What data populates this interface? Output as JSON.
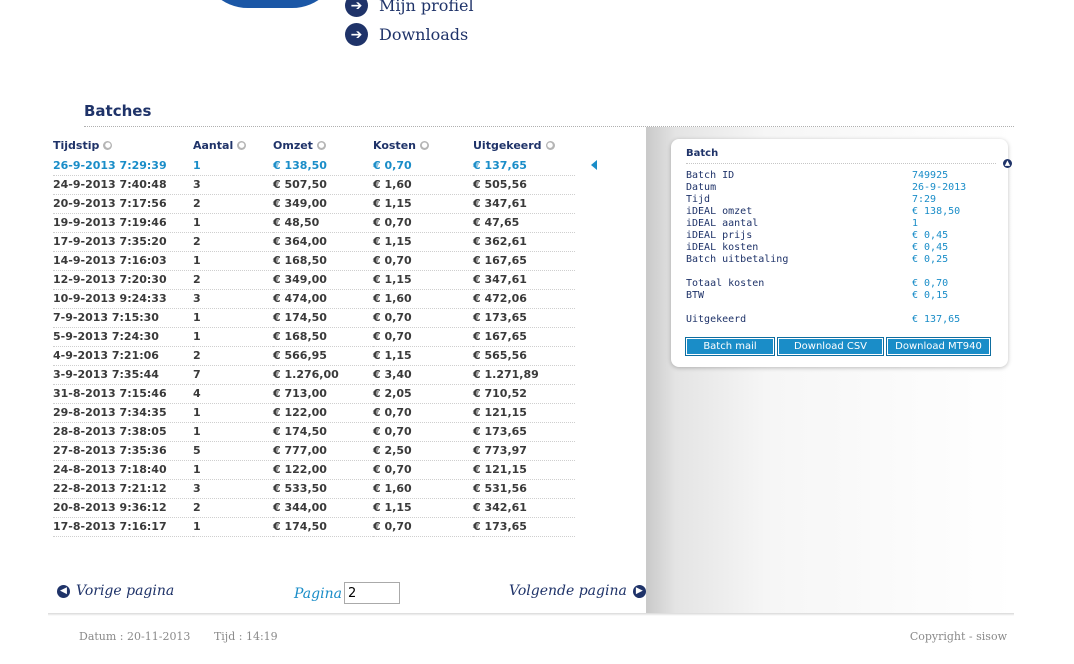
{
  "topnav": {
    "items": [
      {
        "label": "Mijn profiel",
        "icon": "arrow-right-icon"
      },
      {
        "label": "Downloads",
        "icon": "arrow-right-icon"
      }
    ]
  },
  "batches": {
    "title": "Batches",
    "columns": [
      "Tijdstip",
      "Aantal",
      "Omzet",
      "Kosten",
      "Uitgekeerd"
    ],
    "rows": [
      [
        "26-9-2013 7:29:39",
        "1",
        "€ 138,50",
        "€ 0,70",
        "€ 137,65"
      ],
      [
        "24-9-2013 7:40:48",
        "3",
        "€ 507,50",
        "€ 1,60",
        "€ 505,56"
      ],
      [
        "20-9-2013 7:17:56",
        "2",
        "€ 349,00",
        "€ 1,15",
        "€ 347,61"
      ],
      [
        "19-9-2013 7:19:46",
        "1",
        "€ 48,50",
        "€ 0,70",
        "€ 47,65"
      ],
      [
        "17-9-2013 7:35:20",
        "2",
        "€ 364,00",
        "€ 1,15",
        "€ 362,61"
      ],
      [
        "14-9-2013 7:16:03",
        "1",
        "€ 168,50",
        "€ 0,70",
        "€ 167,65"
      ],
      [
        "12-9-2013 7:20:30",
        "2",
        "€ 349,00",
        "€ 1,15",
        "€ 347,61"
      ],
      [
        "10-9-2013 9:24:33",
        "3",
        "€ 474,00",
        "€ 1,60",
        "€ 472,06"
      ],
      [
        "7-9-2013 7:15:30",
        "1",
        "€ 174,50",
        "€ 0,70",
        "€ 173,65"
      ],
      [
        "5-9-2013 7:24:30",
        "1",
        "€ 168,50",
        "€ 0,70",
        "€ 167,65"
      ],
      [
        "4-9-2013 7:21:06",
        "2",
        "€ 566,95",
        "€ 1,15",
        "€ 565,56"
      ],
      [
        "3-9-2013 7:35:44",
        "7",
        "€ 1.276,00",
        "€ 3,40",
        "€ 1.271,89"
      ],
      [
        "31-8-2013 7:15:46",
        "4",
        "€ 713,00",
        "€ 2,05",
        "€ 710,52"
      ],
      [
        "29-8-2013 7:34:35",
        "1",
        "€ 122,00",
        "€ 0,70",
        "€ 121,15"
      ],
      [
        "28-8-2013 7:38:05",
        "1",
        "€ 174,50",
        "€ 0,70",
        "€ 173,65"
      ],
      [
        "27-8-2013 7:35:36",
        "5",
        "€ 777,00",
        "€ 2,50",
        "€ 773,97"
      ],
      [
        "24-8-2013 7:18:40",
        "1",
        "€ 122,00",
        "€ 0,70",
        "€ 121,15"
      ],
      [
        "22-8-2013 7:21:12",
        "3",
        "€ 533,50",
        "€ 1,60",
        "€ 531,56"
      ],
      [
        "20-8-2013 9:36:12",
        "2",
        "€ 344,00",
        "€ 1,15",
        "€ 342,61"
      ],
      [
        "17-8-2013 7:16:17",
        "1",
        "€ 174,50",
        "€ 0,70",
        "€ 173,65"
      ]
    ],
    "selected_index": 0
  },
  "pagination": {
    "prev_label": "Vorige pagina",
    "next_label": "Volgende pagina",
    "page_label": "Pagina",
    "page_value": "2"
  },
  "detail": {
    "title": "Batch",
    "rows": [
      {
        "key": "Batch ID",
        "value": "749925"
      },
      {
        "key": "Datum",
        "value": "26-9-2013"
      },
      {
        "key": "Tijd",
        "value": "7:29"
      },
      {
        "key": "iDEAL omzet",
        "value": "€ 138,50"
      },
      {
        "key": "iDEAL aantal",
        "value": "1"
      },
      {
        "key": "iDEAL prijs",
        "value": "€ 0,45"
      },
      {
        "key": "iDEAL kosten",
        "value": "€ 0,45"
      },
      {
        "key": "Batch uitbetaling",
        "value": "€ 0,25"
      },
      null,
      {
        "key": "Totaal kosten",
        "value": "€ 0,70"
      },
      {
        "key": "BTW",
        "value": "€ 0,15"
      },
      null,
      {
        "key": "Uitgekeerd",
        "value": "€ 137,65"
      }
    ],
    "buttons": [
      "Batch mail",
      "Download CSV",
      "Download MT940"
    ]
  },
  "footer": {
    "date": "Datum : 20-11-2013",
    "time": "Tijd : 14:19",
    "copyright": "Copyright - sisow"
  },
  "colors": {
    "navy": "#1f3369",
    "accent": "#1a8dc8",
    "brand_blue": "#1b57a6"
  }
}
